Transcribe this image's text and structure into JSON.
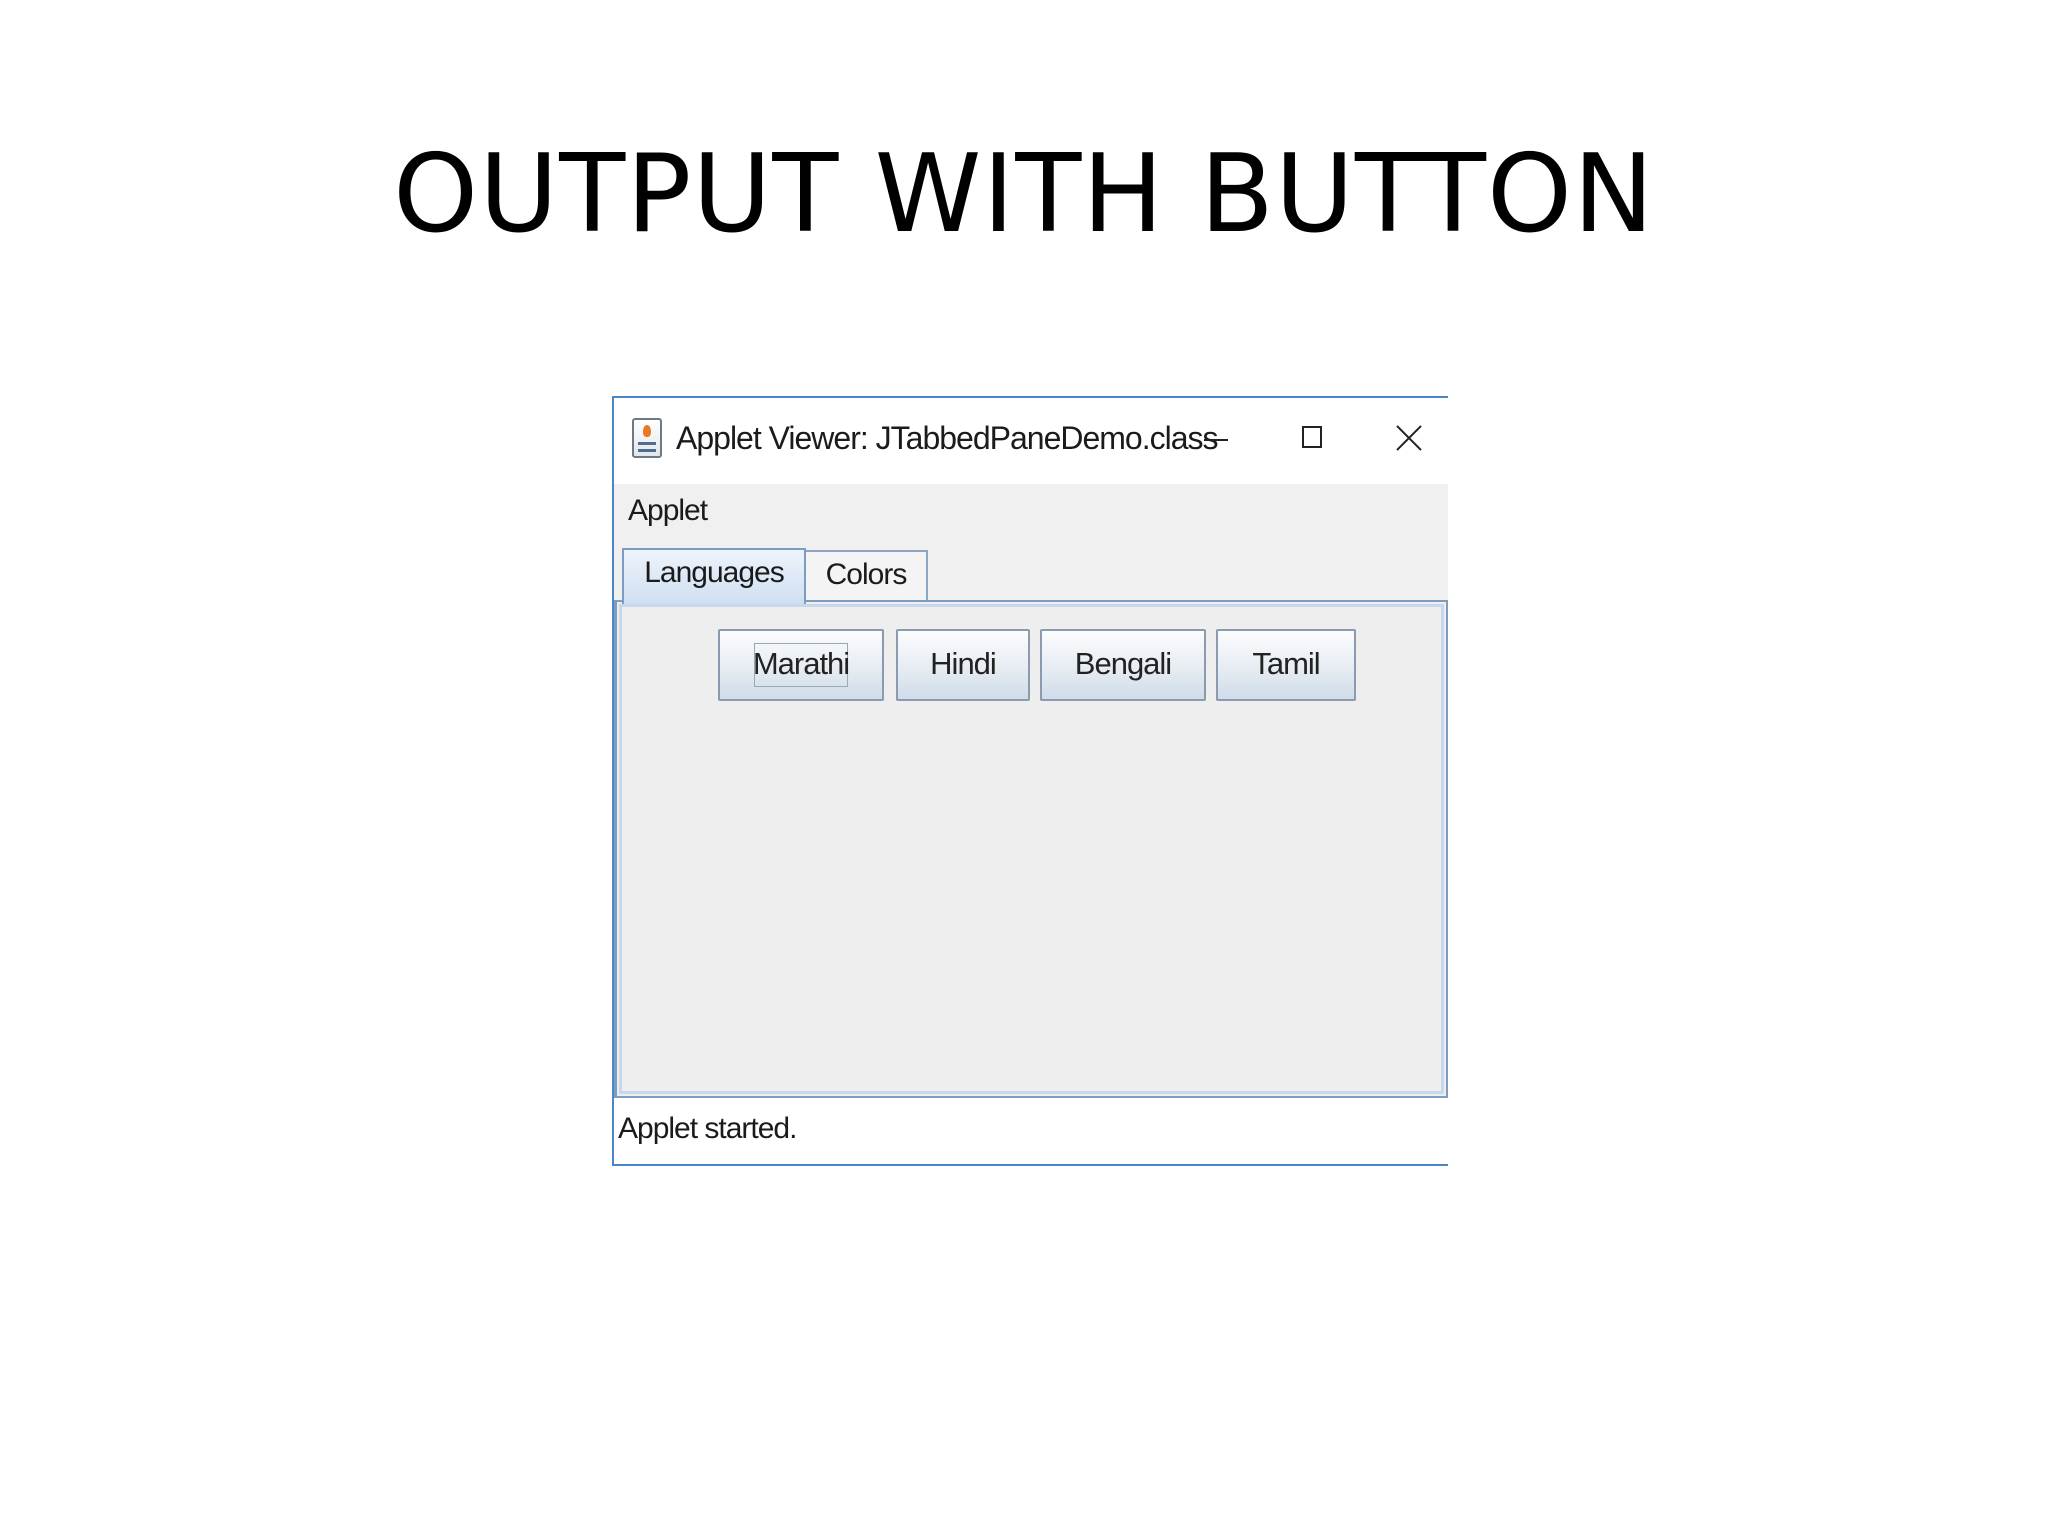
{
  "slide": {
    "title": "OUTPUT WITH BUTTON"
  },
  "window": {
    "title": "Applet Viewer: JTabbedPaneDemo.class",
    "icon": "java-icon",
    "controls": [
      "minimize-icon",
      "maximize-icon",
      "close-icon"
    ]
  },
  "menubar": {
    "items": [
      "Applet"
    ]
  },
  "tabs": [
    {
      "label": "Languages",
      "selected": true
    },
    {
      "label": "Colors",
      "selected": false
    }
  ],
  "buttons": [
    {
      "label": "Marathi",
      "focused": true
    },
    {
      "label": "Hindi",
      "focused": false
    },
    {
      "label": "Bengali",
      "focused": false
    },
    {
      "label": "Tamil",
      "focused": false
    }
  ],
  "status": {
    "text": "Applet started."
  },
  "colors": {
    "window_border": "#4a86c8",
    "panel_background": "#eeeeee",
    "selected_tab": "#cfdff1"
  }
}
